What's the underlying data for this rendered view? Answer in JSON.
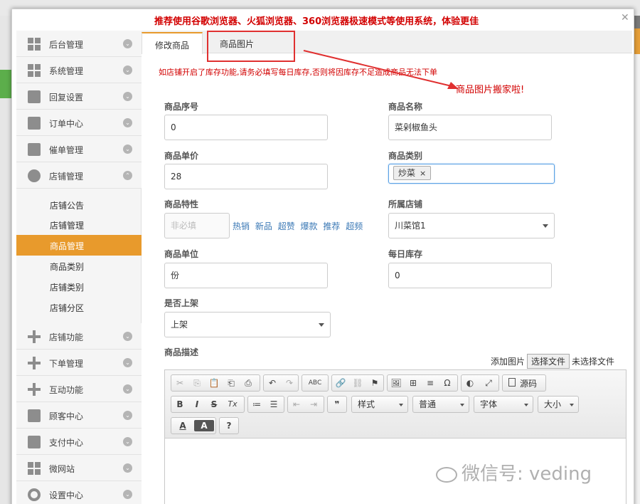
{
  "top_notice": "推荐使用谷歌浏览器、火狐浏览器、360浏览器极速模式等使用系统，体验更佳",
  "close_glyph": "✕",
  "sidebar": {
    "items": [
      {
        "label": "后台管理",
        "icon": "grid-icon"
      },
      {
        "label": "系统管理",
        "icon": "grid-icon"
      },
      {
        "label": "回复设置",
        "icon": "mail-icon"
      },
      {
        "label": "订单中心",
        "icon": "printer-icon"
      },
      {
        "label": "催单管理",
        "icon": "printer-icon"
      },
      {
        "label": "店铺管理",
        "icon": "pie-icon"
      }
    ],
    "sub_items": [
      "店铺公告",
      "店铺管理",
      "商品管理",
      "商品类别",
      "店铺类别",
      "店铺分区"
    ],
    "active_sub": "商品管理",
    "items_after": [
      {
        "label": "店铺功能",
        "icon": "plus-icon"
      },
      {
        "label": "下单管理",
        "icon": "plus-icon"
      },
      {
        "label": "互动功能",
        "icon": "plus-icon"
      },
      {
        "label": "顾客中心",
        "icon": "inbox-icon"
      },
      {
        "label": "支付中心",
        "icon": "inbox-icon"
      },
      {
        "label": "微网站",
        "icon": "grid-icon"
      },
      {
        "label": "设置中心",
        "icon": "gear-icon"
      }
    ],
    "chevron_glyph": "⌄",
    "chevron_up_glyph": "⌃"
  },
  "tabs": [
    "修改商品",
    "商品图片"
  ],
  "warning": "如店铺开启了库存功能,请务必填写每日库存,否则将因库存不足造成商品无法下单",
  "moved_note": "商品图片搬家啦!",
  "form": {
    "serial_label": "商品序号",
    "serial_value": "0",
    "name_label": "商品名称",
    "name_value": "菜剁椒鱼头",
    "price_label": "商品单价",
    "price_value": "28",
    "category_label": "商品类别",
    "category_tag": "炒菜",
    "category_tag_remove": "×",
    "feature_label": "商品特性",
    "feature_placeholder": "非必填",
    "feature_links": [
      "热销",
      "新品",
      "超赞",
      "爆款",
      "推荐",
      "超频"
    ],
    "store_label": "所属店铺",
    "store_value": "川菜馆1",
    "unit_label": "商品单位",
    "unit_value": "份",
    "stock_label": "每日库存",
    "stock_value": "0",
    "shelf_label": "是否上架",
    "shelf_value": "上架",
    "desc_label": "商品描述",
    "add_image": "添加图片",
    "choose_file": "选择文件",
    "no_file": "未选择文件"
  },
  "editor": {
    "row1": [
      "✂",
      "⎘",
      "📋",
      "⎗",
      "⎙",
      "↶",
      "↷",
      "ABC",
      "🔗",
      "⛓",
      "⚑",
      "🖼",
      "⊞",
      "≡",
      "Ω",
      "◐",
      "⤢"
    ],
    "source_label": "源码",
    "row2_buttons": [
      "B",
      "I",
      "S",
      "Tx",
      "≔",
      "☰",
      "⇤",
      "⇥",
      "❞"
    ],
    "styles_label": "样式",
    "format_label": "普通",
    "font_label": "字体",
    "size_label": "大小",
    "row3": [
      "A",
      "A",
      "?"
    ]
  },
  "watermark": "微信号: veding"
}
